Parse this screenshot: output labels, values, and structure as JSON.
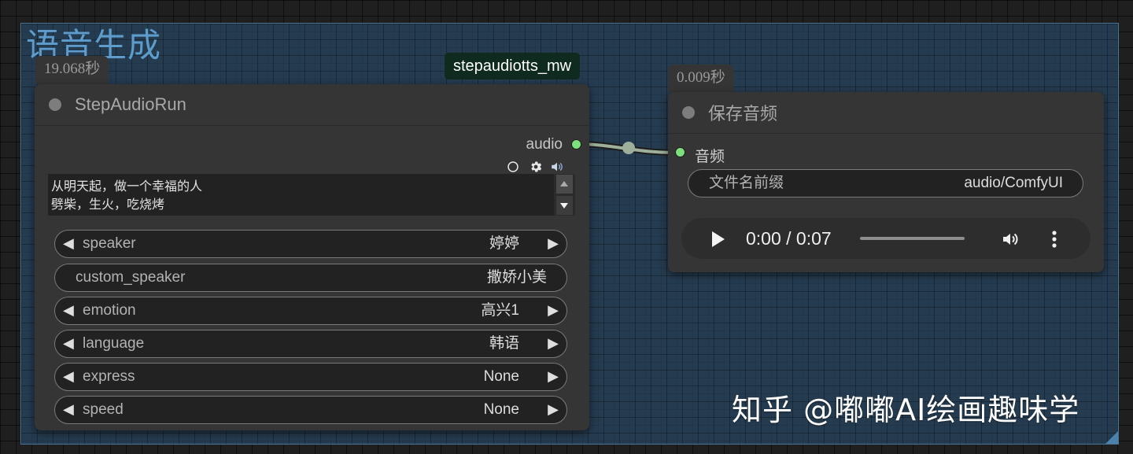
{
  "group": {
    "title": "语音生成"
  },
  "edge_label": "stepaudiotts_mw",
  "step_node": {
    "timing_badge": "19.068秒",
    "title": "StepAudioRun",
    "output_label": "audio",
    "text_lines": [
      "从明天起，做一个幸福的人",
      "劈柴，生火，吃烧烤"
    ],
    "widgets": [
      {
        "label": "speaker",
        "value": "婷婷",
        "arrows": true
      },
      {
        "label": "custom_speaker",
        "value": "撒娇小美",
        "arrows": false
      },
      {
        "label": "emotion",
        "value": "高兴1",
        "arrows": true
      },
      {
        "label": "language",
        "value": "韩语",
        "arrows": true
      },
      {
        "label": "express",
        "value": "None",
        "arrows": true
      },
      {
        "label": "speed",
        "value": "None",
        "arrows": true
      }
    ],
    "arrow_left": "◀",
    "arrow_right": "▶"
  },
  "save_node": {
    "timing_badge": "0.009秒",
    "title": "保存音频",
    "input_label": "音频",
    "prefix_label": "文件名前缀",
    "prefix_value": "audio/ComfyUI",
    "player": {
      "time": "0:00 / 0:07"
    }
  },
  "watermark": "知乎 @嘟嘟AI绘画趣味学",
  "colors": {
    "slot_green": "#7ce17c",
    "group_blue": "#5e9ccc",
    "label_bg": "#0f2a1e",
    "node_bg": "#353535"
  },
  "icons": [
    "circle-outline-icon",
    "gear-icon",
    "speaker-icon",
    "play-icon",
    "volume-icon",
    "more-vertical-icon"
  ]
}
